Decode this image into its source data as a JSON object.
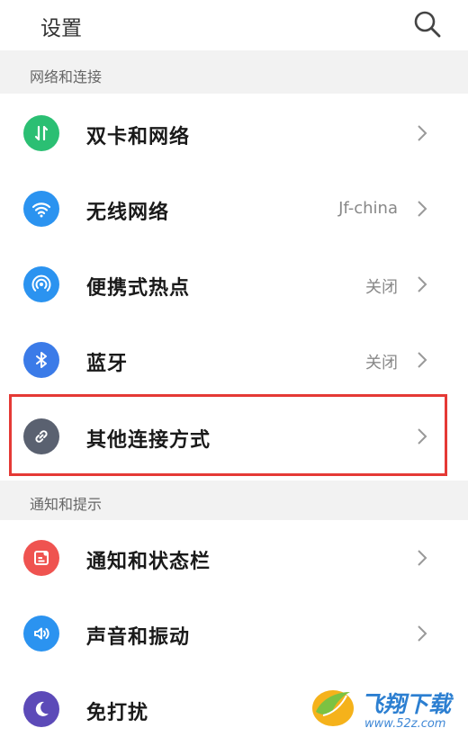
{
  "header": {
    "title": "设置",
    "search_icon": "search-icon"
  },
  "sections": [
    {
      "title": "网络和连接"
    },
    {
      "title": "通知和提示"
    }
  ],
  "rows": [
    {
      "label": "双卡和网络",
      "value": "",
      "icon": "sim-data-icon",
      "color": "#2bbf73"
    },
    {
      "label": "无线网络",
      "value": "Jf-china",
      "icon": "wifi-icon",
      "color": "#2b93f0"
    },
    {
      "label": "便携式热点",
      "value": "关闭",
      "icon": "hotspot-icon",
      "color": "#2b93f0"
    },
    {
      "label": "蓝牙",
      "value": "关闭",
      "icon": "bluetooth-icon",
      "color": "#3b7be8"
    },
    {
      "label": "其他连接方式",
      "value": "",
      "icon": "link-icon",
      "color": "#5a6170"
    },
    {
      "label": "通知和状态栏",
      "value": "",
      "icon": "notification-icon",
      "color": "#ef5350"
    },
    {
      "label": "声音和振动",
      "value": "",
      "icon": "sound-icon",
      "color": "#2b93f0"
    },
    {
      "label": "免打扰",
      "value": "",
      "icon": "moon-icon",
      "color": "#5c4ab8"
    }
  ],
  "watermark": {
    "text": "飞翔下载",
    "url": "www.52z.com"
  }
}
